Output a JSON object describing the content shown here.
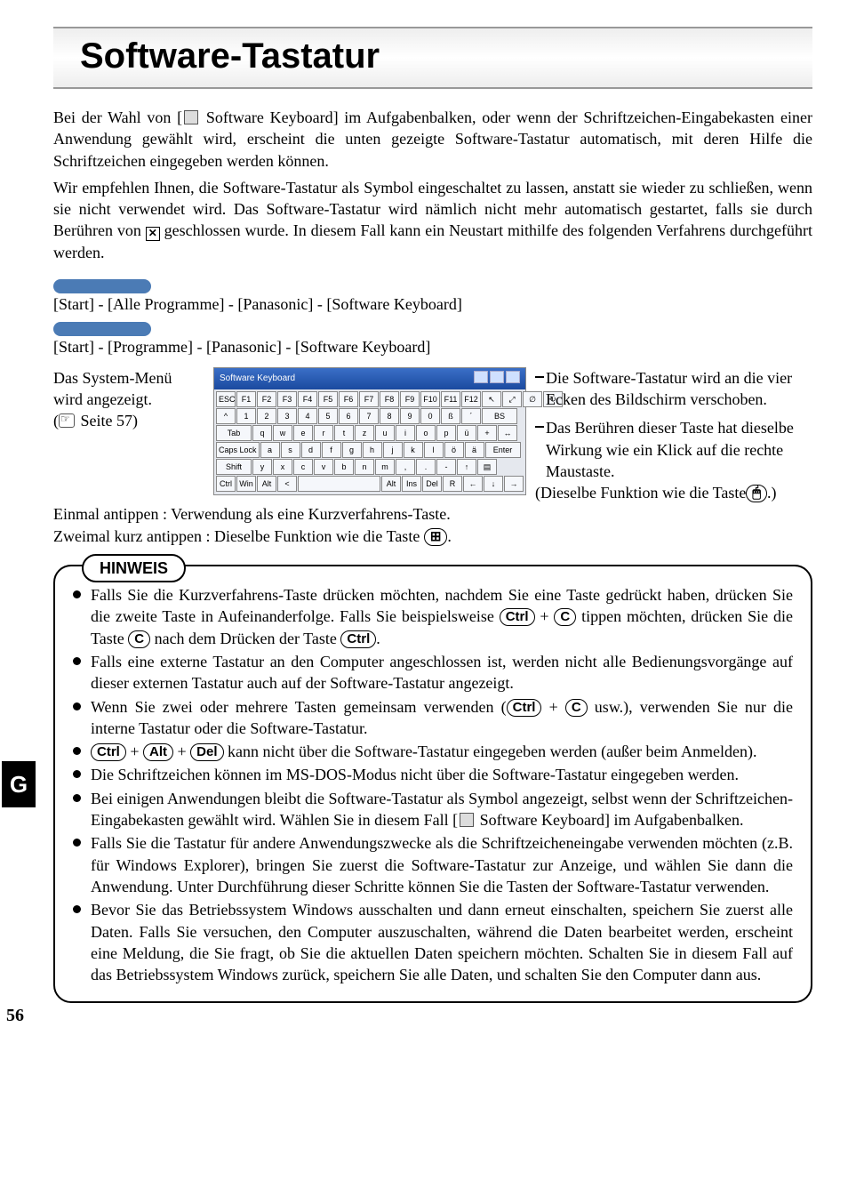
{
  "title": "Software-Tastatur",
  "para1_a": "Bei der Wahl von [",
  "para1_b": " Software Keyboard] im Aufgabenbalken, oder wenn der Schriftzeichen-Eingabekasten einer Anwendung gewählt wird, erscheint die unten gezeigte Software-Tastatur automatisch, mit deren Hilfe die Schriftzeichen eingegeben werden können.",
  "para2_a": "Wir empfehlen Ihnen, die Software-Tastatur als Symbol eingeschaltet zu lassen, anstatt sie wieder zu schließen, wenn sie nicht verwendet wird. Das Software-Tastatur wird nämlich nicht mehr automatisch gestartet, falls sie durch Berühren von ",
  "para2_b": " geschlossen wurde. In diesem Fall kann ein Neustart mithilfe des folgenden Verfahrens durchgeführt werden.",
  "x_glyph": "✕",
  "path1": "[Start] - [Alle Programme] - [Panasonic] - [Software Keyboard]",
  "path2": "[Start] - [Programme] - [Panasonic] - [Software Keyboard]",
  "left_note1": "Das System-Menü wird angezeigt.",
  "left_note2_a": "(",
  "left_note2_b": " Seite 57)",
  "kbTitle": "Software Keyboard",
  "right_note1": "Die Software-Tastatur wird an die vier Ecken des Bildschirm verschoben.",
  "right_note2": "Das Berühren dieser Taste hat dieselbe Wirkung wie ein Klick auf die rechte Maustaste.",
  "right_note3_a": "(Dieselbe Funktion wie die Taste",
  "right_note3_b": ".)",
  "mouse_glyph": "🖱",
  "tap1": "Einmal antippen : Verwendung als eine Kurzverfahrens-Taste.",
  "tap2_a": "Zweimal kurz antippen : Dieselbe Funktion wie die Taste",
  "tap2_b": ".",
  "win_glyph": "⊞",
  "hinweisLabel": "HINWEIS",
  "keys": {
    "ctrl": "Ctrl",
    "c": "C",
    "alt": "Alt",
    "del": "Del"
  },
  "notes": {
    "n1a": "Falls Sie die Kurzverfahrens-Taste drücken möchten, nachdem Sie eine Taste gedrückt haben, drücken Sie die zweite Taste in Aufeinanderfolge. Falls Sie beispielsweise ",
    "n1b": " + ",
    "n1c": " tippen möchten, drücken Sie die Taste ",
    "n1d": " nach dem Drücken der Taste ",
    "n1e": ".",
    "n2": "Falls eine externe Tastatur an den Computer angeschlossen ist, werden nicht alle Bedienungsvorgänge auf dieser externen Tastatur auch auf der Software-Tastatur angezeigt.",
    "n3a": "Wenn Sie zwei oder mehrere Tasten gemeinsam verwenden (",
    "n3b": " + ",
    "n3c": " usw.), verwenden Sie nur die interne Tastatur oder die Software-Tastatur.",
    "n4a": " + ",
    "n4b": " + ",
    "n4c": " kann nicht über die Software-Tastatur eingegeben werden (außer beim Anmelden).",
    "n5": "Die Schriftzeichen können im MS-DOS-Modus nicht über die Software-Tastatur eingegeben werden.",
    "n6a": "Bei einigen Anwendungen bleibt die Software-Tastatur als Symbol angezeigt, selbst wenn der Schriftzeichen-Eingabekasten gewählt wird. Wählen Sie in diesem Fall [",
    "n6b": " Software Keyboard] im Aufgabenbalken.",
    "n7": "Falls Sie die Tastatur für andere Anwendungszwecke als die Schriftzeicheneingabe verwenden möchten (z.B. für Windows Explorer), bringen Sie zuerst die Software-Tastatur zur Anzeige, und wählen Sie dann die Anwendung. Unter Durchführung dieser Schritte können Sie die Tasten der Software-Tastatur verwenden.",
    "n8": "Bevor Sie das Betriebssystem Windows ausschalten und dann erneut einschalten, speichern Sie zuerst alle Daten. Falls Sie versuchen, den Computer auszuschalten, während die Daten bearbeitet werden, erscheint eine Meldung, die Sie fragt, ob Sie die aktuellen Daten speichern möchten. Schalten Sie in diesem Fall auf das Betriebssystem Windows zurück, speichern Sie alle Daten, und schalten Sie den Computer dann aus."
  },
  "sideTab": "G",
  "pageNum": "56",
  "kb": {
    "r0": [
      "ESC",
      "F1",
      "F2",
      "F3",
      "F4",
      "F5",
      "F6",
      "F7",
      "F8",
      "F9",
      "F10",
      "F11",
      "F12",
      "↖",
      "⤢",
      "∅",
      "↻"
    ],
    "r1": [
      "^",
      "1",
      "2",
      "3",
      "4",
      "5",
      "6",
      "7",
      "8",
      "9",
      "0",
      "ß",
      "´",
      "BS"
    ],
    "r2": [
      "Tab",
      "q",
      "w",
      "e",
      "r",
      "t",
      "z",
      "u",
      "i",
      "o",
      "p",
      "ü",
      "+",
      "↔"
    ],
    "r3": [
      "Caps Lock",
      "a",
      "s",
      "d",
      "f",
      "g",
      "h",
      "j",
      "k",
      "l",
      "ö",
      "ä",
      "Enter"
    ],
    "r4": [
      "Shift",
      "y",
      "x",
      "c",
      "v",
      "b",
      "n",
      "m",
      ",",
      ".",
      "-",
      "↑",
      "▤"
    ],
    "r5": [
      "Ctrl",
      "Win",
      "Alt",
      "<",
      "",
      "Alt",
      "Ins",
      "Del",
      "R",
      "←",
      "↓",
      "→"
    ]
  }
}
